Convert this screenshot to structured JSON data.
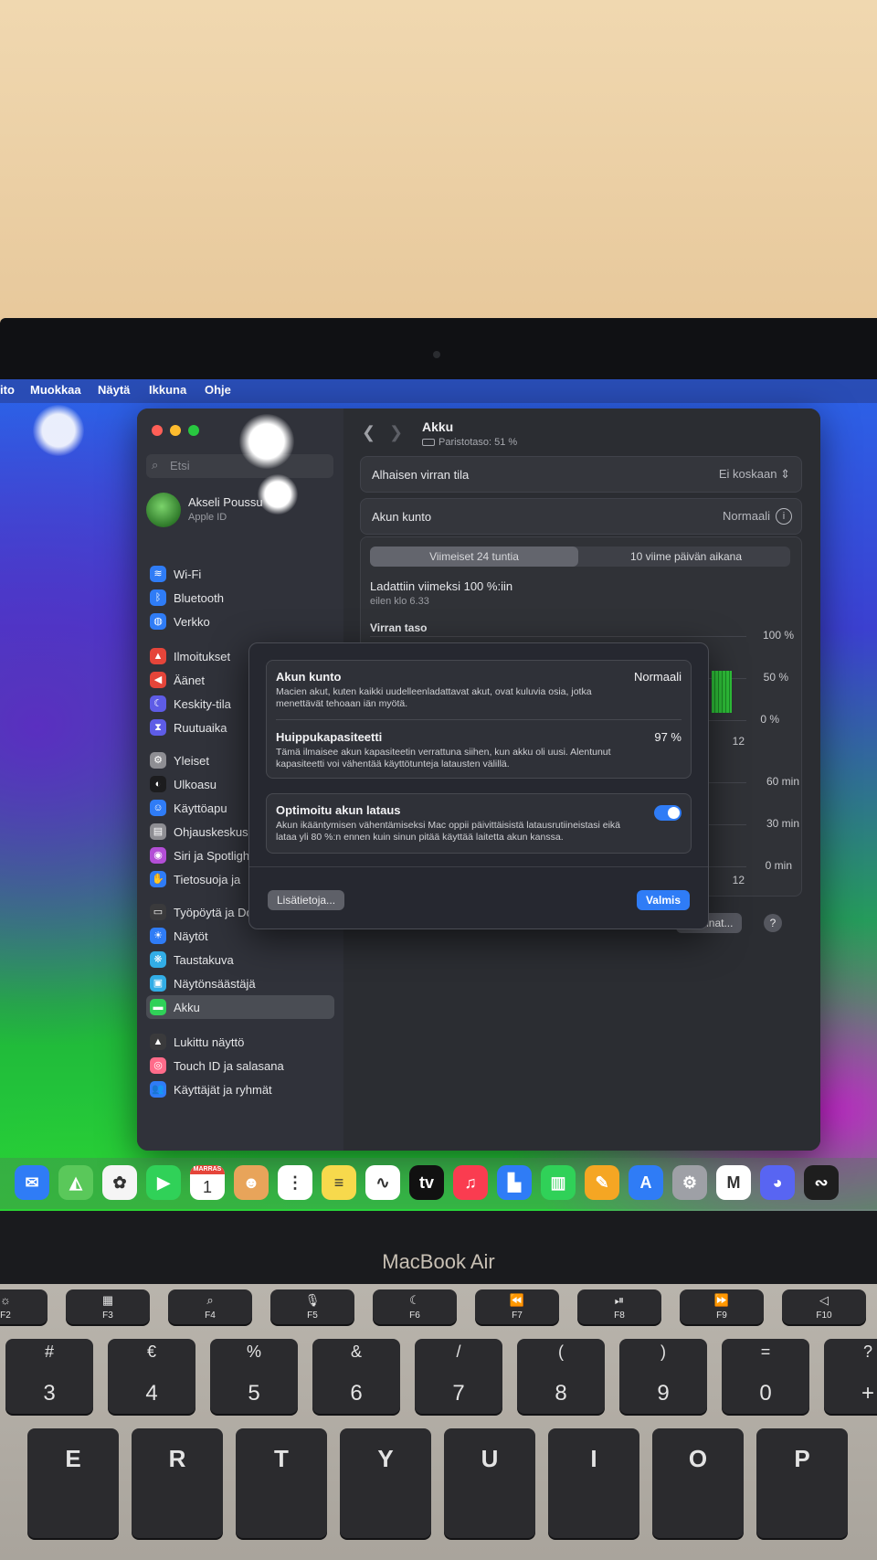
{
  "menubar": [
    "ito",
    "Muokkaa",
    "Näytä",
    "Ikkuna",
    "Ohje"
  ],
  "search_placeholder": "Etsi",
  "profile": {
    "name": "Akseli Poussu",
    "sub": "Apple ID"
  },
  "sidebar": [
    {
      "label": "Wi-Fi",
      "icon": "wifi-icon",
      "color": "#2f7cf6",
      "glyph": "≋"
    },
    {
      "label": "Bluetooth",
      "icon": "bluetooth-icon",
      "color": "#2f7cf6",
      "glyph": "ᛒ"
    },
    {
      "label": "Verkko",
      "icon": "globe-icon",
      "color": "#2f7cf6",
      "glyph": "◍"
    },
    {
      "label": "Ilmoitukset",
      "icon": "bell-icon",
      "color": "#e5453a",
      "glyph": "▲"
    },
    {
      "label": "Äänet",
      "icon": "speaker-icon",
      "color": "#e5453a",
      "glyph": "◀"
    },
    {
      "label": "Keskity-tila",
      "icon": "moon-icon",
      "color": "#5e5ce6",
      "glyph": "☾"
    },
    {
      "label": "Ruutuaika",
      "icon": "hourglass-icon",
      "color": "#5e5ce6",
      "glyph": "⧗"
    },
    {
      "label": "Yleiset",
      "icon": "gear-icon",
      "color": "#8e8e93",
      "glyph": "⚙"
    },
    {
      "label": "Ulkoasu",
      "icon": "appearance-icon",
      "color": "#1c1c1e",
      "glyph": "◐"
    },
    {
      "label": "Käyttöapu",
      "icon": "accessibility-icon",
      "color": "#2f7cf6",
      "glyph": "☺"
    },
    {
      "label": "Ohjauskeskus",
      "icon": "control-center-icon",
      "color": "#8e8e93",
      "glyph": "▤"
    },
    {
      "label": "Siri ja Spotlight",
      "icon": "siri-icon",
      "color": "#b34ed6",
      "glyph": "◉"
    },
    {
      "label": "Tietosuoja ja",
      "icon": "hand-icon",
      "color": "#2f7cf6",
      "glyph": "✋"
    },
    {
      "label": "Työpöytä ja Dock",
      "icon": "dock-icon",
      "color": "#3a3a3c",
      "glyph": "▭"
    },
    {
      "label": "Näytöt",
      "icon": "display-icon",
      "color": "#2f7cf6",
      "glyph": "☀"
    },
    {
      "label": "Taustakuva",
      "icon": "wallpaper-icon",
      "color": "#32ade6",
      "glyph": "❋"
    },
    {
      "label": "Näytönsäästäjä",
      "icon": "screensaver-icon",
      "color": "#32ade6",
      "glyph": "▣"
    },
    {
      "label": "Akku",
      "icon": "battery-icon",
      "color": "#30d158",
      "glyph": "▬"
    },
    {
      "label": "Lukittu näyttö",
      "icon": "lock-screen-icon",
      "color": "#3a3a3c",
      "glyph": "▲"
    },
    {
      "label": "Touch ID ja salasana",
      "icon": "fingerprint-icon",
      "color": "#ff6b8a",
      "glyph": "◎"
    },
    {
      "label": "Käyttäjät ja ryhmät",
      "icon": "users-icon",
      "color": "#2f7cf6",
      "glyph": "👥"
    }
  ],
  "header": {
    "title": "Akku",
    "subtitle": "Paristotaso: 51 %"
  },
  "low_power": {
    "label": "Alhaisen virran tila",
    "value": "Ei koskaan"
  },
  "health_row": {
    "label": "Akun kunto",
    "value": "Normaali"
  },
  "usage": {
    "tabs": [
      "Viimeiset 24 tuntia",
      "10 viime päivän aikana"
    ],
    "last_charged": "Ladattiin viimeksi 100 %:iin",
    "last_charged_time": "eilen klo 6.33",
    "battery_section": "Virran taso",
    "y1_ticks": [
      "100 %",
      "50 %",
      "0 %"
    ],
    "y2_ticks": [
      "60 min",
      "30 min",
      "0 min"
    ],
    "x_tick": "12"
  },
  "footer": {
    "options": "Valinnat...",
    "help": "?"
  },
  "sheet": {
    "health_title": "Akun kunto",
    "health_value": "Normaali",
    "health_desc": "Macien akut, kuten kaikki uudelleenladattavat akut, ovat kuluvia osia, jotka menettävät tehoaan iän myötä.",
    "capacity_title": "Huippukapasiteetti",
    "capacity_value": "97 %",
    "capacity_desc": "Tämä ilmaisee akun kapasiteetin verrattuna siihen, kun akku oli uusi. Alentunut kapasiteetti voi vähentää käyttötunteja latausten välillä.",
    "optimized_title": "Optimoitu akun lataus",
    "optimized_desc": "Akun ikääntymisen vähentämiseksi Mac oppii päivittäisistä latausrutiineistasi eikä lataa yli 80 %:n ennen kuin sinun pitää käyttää laitetta akun kanssa.",
    "optimized_on": true,
    "more_button": "Lisätietoja...",
    "done_button": "Valmis"
  },
  "calendar": {
    "month": "MARRAS",
    "day": "1"
  },
  "dock": [
    {
      "name": "mail-icon",
      "color": "#2f7cf6",
      "glyph": "✉"
    },
    {
      "name": "maps-icon",
      "color": "#5ac85a",
      "glyph": "◭"
    },
    {
      "name": "photos-icon",
      "color": "#f5f5f5",
      "glyph": "✿"
    },
    {
      "name": "facetime-icon",
      "color": "#30d158",
      "glyph": "▶"
    },
    {
      "name": "calendar-icon",
      "color": "#ffffff",
      "glyph": "1"
    },
    {
      "name": "contacts-icon",
      "color": "#e8a45a",
      "glyph": "☻"
    },
    {
      "name": "reminders-icon",
      "color": "#ffffff",
      "glyph": "⋮"
    },
    {
      "name": "notes-icon",
      "color": "#f7d94c",
      "glyph": "≡"
    },
    {
      "name": "freeform-icon",
      "color": "#ffffff",
      "glyph": "∿"
    },
    {
      "name": "appletv-icon",
      "color": "#111111",
      "glyph": "tv"
    },
    {
      "name": "music-icon",
      "color": "#fa3c50",
      "glyph": "♫"
    },
    {
      "name": "keynote-icon",
      "color": "#2f7cf6",
      "glyph": "▙"
    },
    {
      "name": "numbers-icon",
      "color": "#30d158",
      "glyph": "▥"
    },
    {
      "name": "pages-icon",
      "color": "#f5a623",
      "glyph": "✎"
    },
    {
      "name": "appstore-icon",
      "color": "#2f7cf6",
      "glyph": "A"
    },
    {
      "name": "system-settings-icon",
      "color": "#9ea0a6",
      "glyph": "⚙"
    },
    {
      "name": "gmail-icon",
      "color": "#ffffff",
      "glyph": "M"
    },
    {
      "name": "discord-icon",
      "color": "#5865f2",
      "glyph": "◕"
    },
    {
      "name": "app-icon",
      "color": "#1e1e1e",
      "glyph": "∾"
    }
  ],
  "brand": "MacBook Air",
  "keys_frow": [
    {
      "top": "☼",
      "bot": "F2"
    },
    {
      "top": "▦",
      "bot": "F3"
    },
    {
      "top": "⌕",
      "bot": "F4"
    },
    {
      "top": "🎙",
      "bot": "F5"
    },
    {
      "top": "☾",
      "bot": "F6"
    },
    {
      "top": "⏪",
      "bot": "F7"
    },
    {
      "top": "⏯",
      "bot": "F8"
    },
    {
      "top": "⏩",
      "bot": "F9"
    },
    {
      "top": "◁",
      "bot": "F10"
    }
  ],
  "keys_num": [
    {
      "top": "#",
      "bot": "3"
    },
    {
      "top": "€",
      "bot": "4"
    },
    {
      "top": "%",
      "bot": "5"
    },
    {
      "top": "&",
      "bot": "6"
    },
    {
      "top": "/",
      "bot": "7"
    },
    {
      "top": "(",
      "bot": "8"
    },
    {
      "top": ")",
      "bot": "9"
    },
    {
      "top": "=",
      "bot": "0"
    },
    {
      "top": "?",
      "bot": "+"
    }
  ],
  "keys_letters": [
    "E",
    "R",
    "T",
    "Y",
    "U",
    "I",
    "O",
    "P"
  ]
}
